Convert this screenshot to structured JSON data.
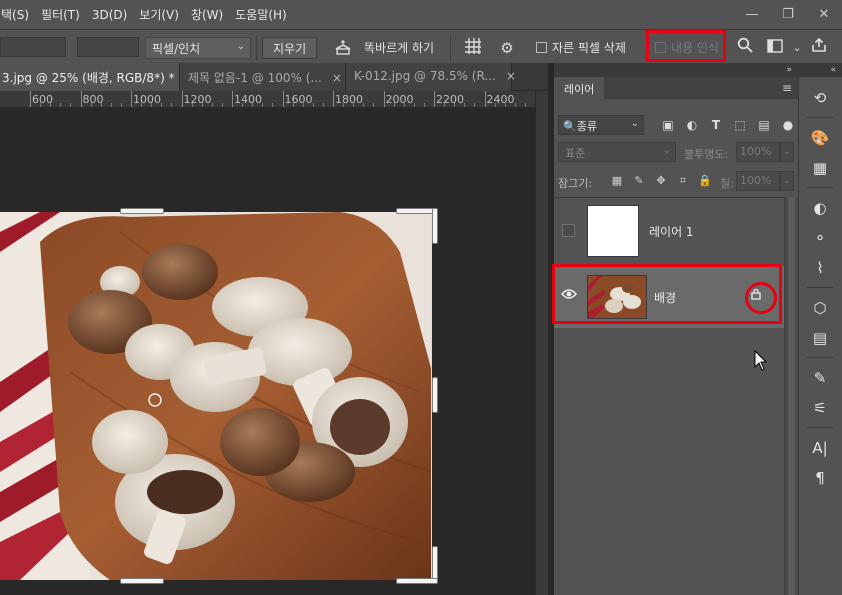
{
  "menu": {
    "items": [
      "택(S)",
      "필터(T)",
      "3D(D)",
      "보기(V)",
      "창(W)",
      "도움말(H)"
    ],
    "window_controls": [
      "—",
      "❐",
      "✕"
    ]
  },
  "options": {
    "unit_select": "픽셀/인치",
    "clear_button": "지우기",
    "straighten_label": "똑바르게 하기",
    "delete_cropped_label": "자른 픽셀 삭제",
    "content_aware_label": "내용 인식"
  },
  "tabs": [
    {
      "label": "3.jpg @ 25% (배경, RGB/8*) *",
      "active": true
    },
    {
      "label": "제목 없음-1 @ 100% (...",
      "active": false
    },
    {
      "label": "K-012.jpg @ 78.5% (R...",
      "active": false
    }
  ],
  "ruler": {
    "labels": [
      "600",
      "800",
      "1000",
      "1200",
      "1400",
      "1600",
      "1800",
      "2000",
      "2200",
      "2400"
    ]
  },
  "layers_panel": {
    "tab": "레이어",
    "collapse": "»",
    "menu": "≡",
    "filter_kind": "종류",
    "blend_mode": "표준",
    "opacity_label": "불투명도:",
    "opacity_value": "100%",
    "lock_label": "잠그기:",
    "fill_label": "칠:",
    "fill_value": "100%",
    "layers": [
      {
        "name": "레이어 1",
        "visible": false,
        "selected": false,
        "locked": false
      },
      {
        "name": "배경",
        "visible": true,
        "selected": true,
        "locked": true
      }
    ]
  },
  "toolstrip": {
    "collapse": "«"
  },
  "colors": {
    "highlight_red": "#e60012",
    "panel_bg": "#535353",
    "canvas_bg": "#282828"
  }
}
